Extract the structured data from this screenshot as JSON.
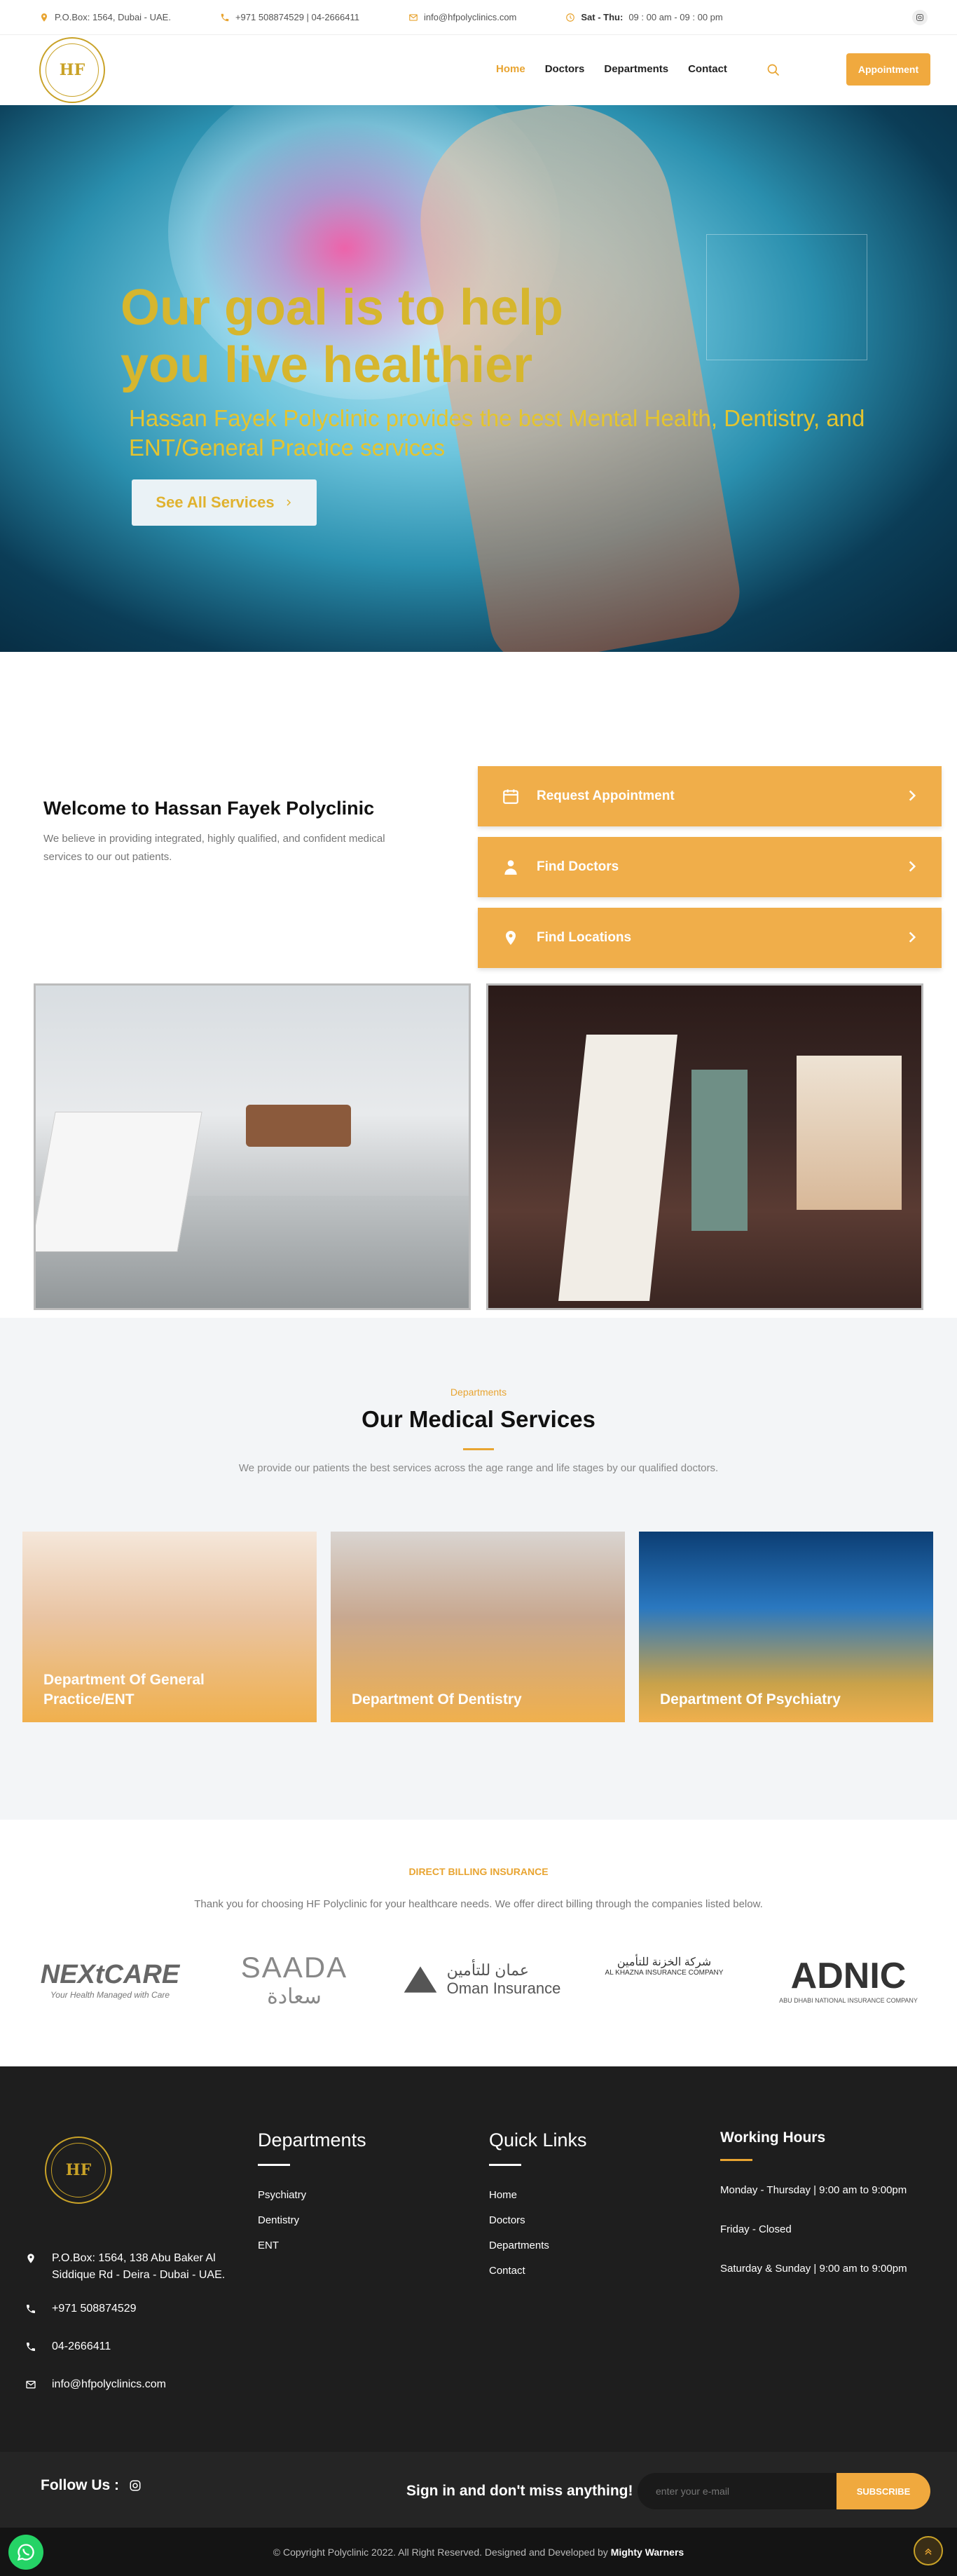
{
  "topbar": {
    "address": "P.O.Box: 1564, Dubai - UAE.",
    "phone": "+971 508874529 | 04-2666411",
    "email": "info@hfpolyclinics.com",
    "hours_label": "Sat - Thu:",
    "hours": "09 : 00 am - 09 : 00 pm"
  },
  "nav": {
    "logo_text": "HF",
    "items": [
      "Home",
      "Doctors",
      "Departments",
      "Contact"
    ],
    "appointment_label": "Appointment"
  },
  "hero": {
    "title_line1": "Our goal is to help",
    "title_line2": "you live healthier",
    "subtitle": "Hassan Fayek Polyclinic provides the best Mental Health, Dentistry, and ENT/General Practice services",
    "button": "See All Services"
  },
  "welcome": {
    "title": "Welcome to Hassan Fayek Polyclinic",
    "text": "We believe in providing integrated, highly qualified, and confident medical services to our out patients.",
    "links": [
      "Request Appointment",
      "Find Doctors",
      "Find Locations"
    ]
  },
  "services": {
    "tag": "Departments",
    "title": "Our Medical Services",
    "desc": "We provide our patients the best services across the age range and life stages by our qualified doctors.",
    "cards": [
      "Department Of General Practice/ENT",
      "Department Of Dentistry",
      "Department Of Psychiatry"
    ]
  },
  "billing": {
    "title": "DIRECT BILLING INSURANCE",
    "desc": "Thank you for choosing HF Polyclinic for your healthcare needs. We offer direct billing through the companies listed below.",
    "logos": [
      {
        "name": "NEXtCARE",
        "tagline": "Your Health Managed with Care"
      },
      {
        "name": "SAADA",
        "tagline": "سعادة"
      },
      {
        "name": "Oman Insurance",
        "tagline": "عمان للتأمين"
      },
      {
        "name": "AL KHAZNA INSURANCE COMPANY",
        "tagline": "شركة الخزنة للتأمين"
      },
      {
        "name": "ADNIC",
        "tagline": "ABU DHABI NATIONAL INSURANCE COMPANY"
      }
    ]
  },
  "footer": {
    "address": "P.O.Box: 1564, 138 Abu Baker Al Siddique Rd - Deira - Dubai - UAE.",
    "phone1": "+971 508874529",
    "phone2": "04-2666411",
    "email": "info@hfpolyclinics.com",
    "departments_title": "Departments",
    "departments": [
      "Psychiatry",
      "Dentistry",
      "ENT"
    ],
    "quicklinks_title": "Quick Links",
    "quicklinks": [
      "Home",
      "Doctors",
      "Departments",
      "Contact"
    ],
    "hours_title": "Working Hours",
    "hours": [
      "Monday - Thursday | 9:00 am to 9:00pm",
      "Friday - Closed",
      "Saturday & Sunday | 9:00 am to 9:00pm"
    ]
  },
  "newsletter": {
    "follow": "Follow Us :",
    "signin": "Sign in and don't miss anything!",
    "placeholder": "enter your e-mail",
    "button": "SUBSCRIBE"
  },
  "copyright": {
    "text": "© Copyright Polyclinic 2022. All Right Reserved. Designed and Developed by",
    "brand": "Mighty Warners"
  },
  "colors": {
    "accent": "#f0a93e",
    "gold": "#c9a227",
    "footer_bg": "#1e1e1e"
  }
}
